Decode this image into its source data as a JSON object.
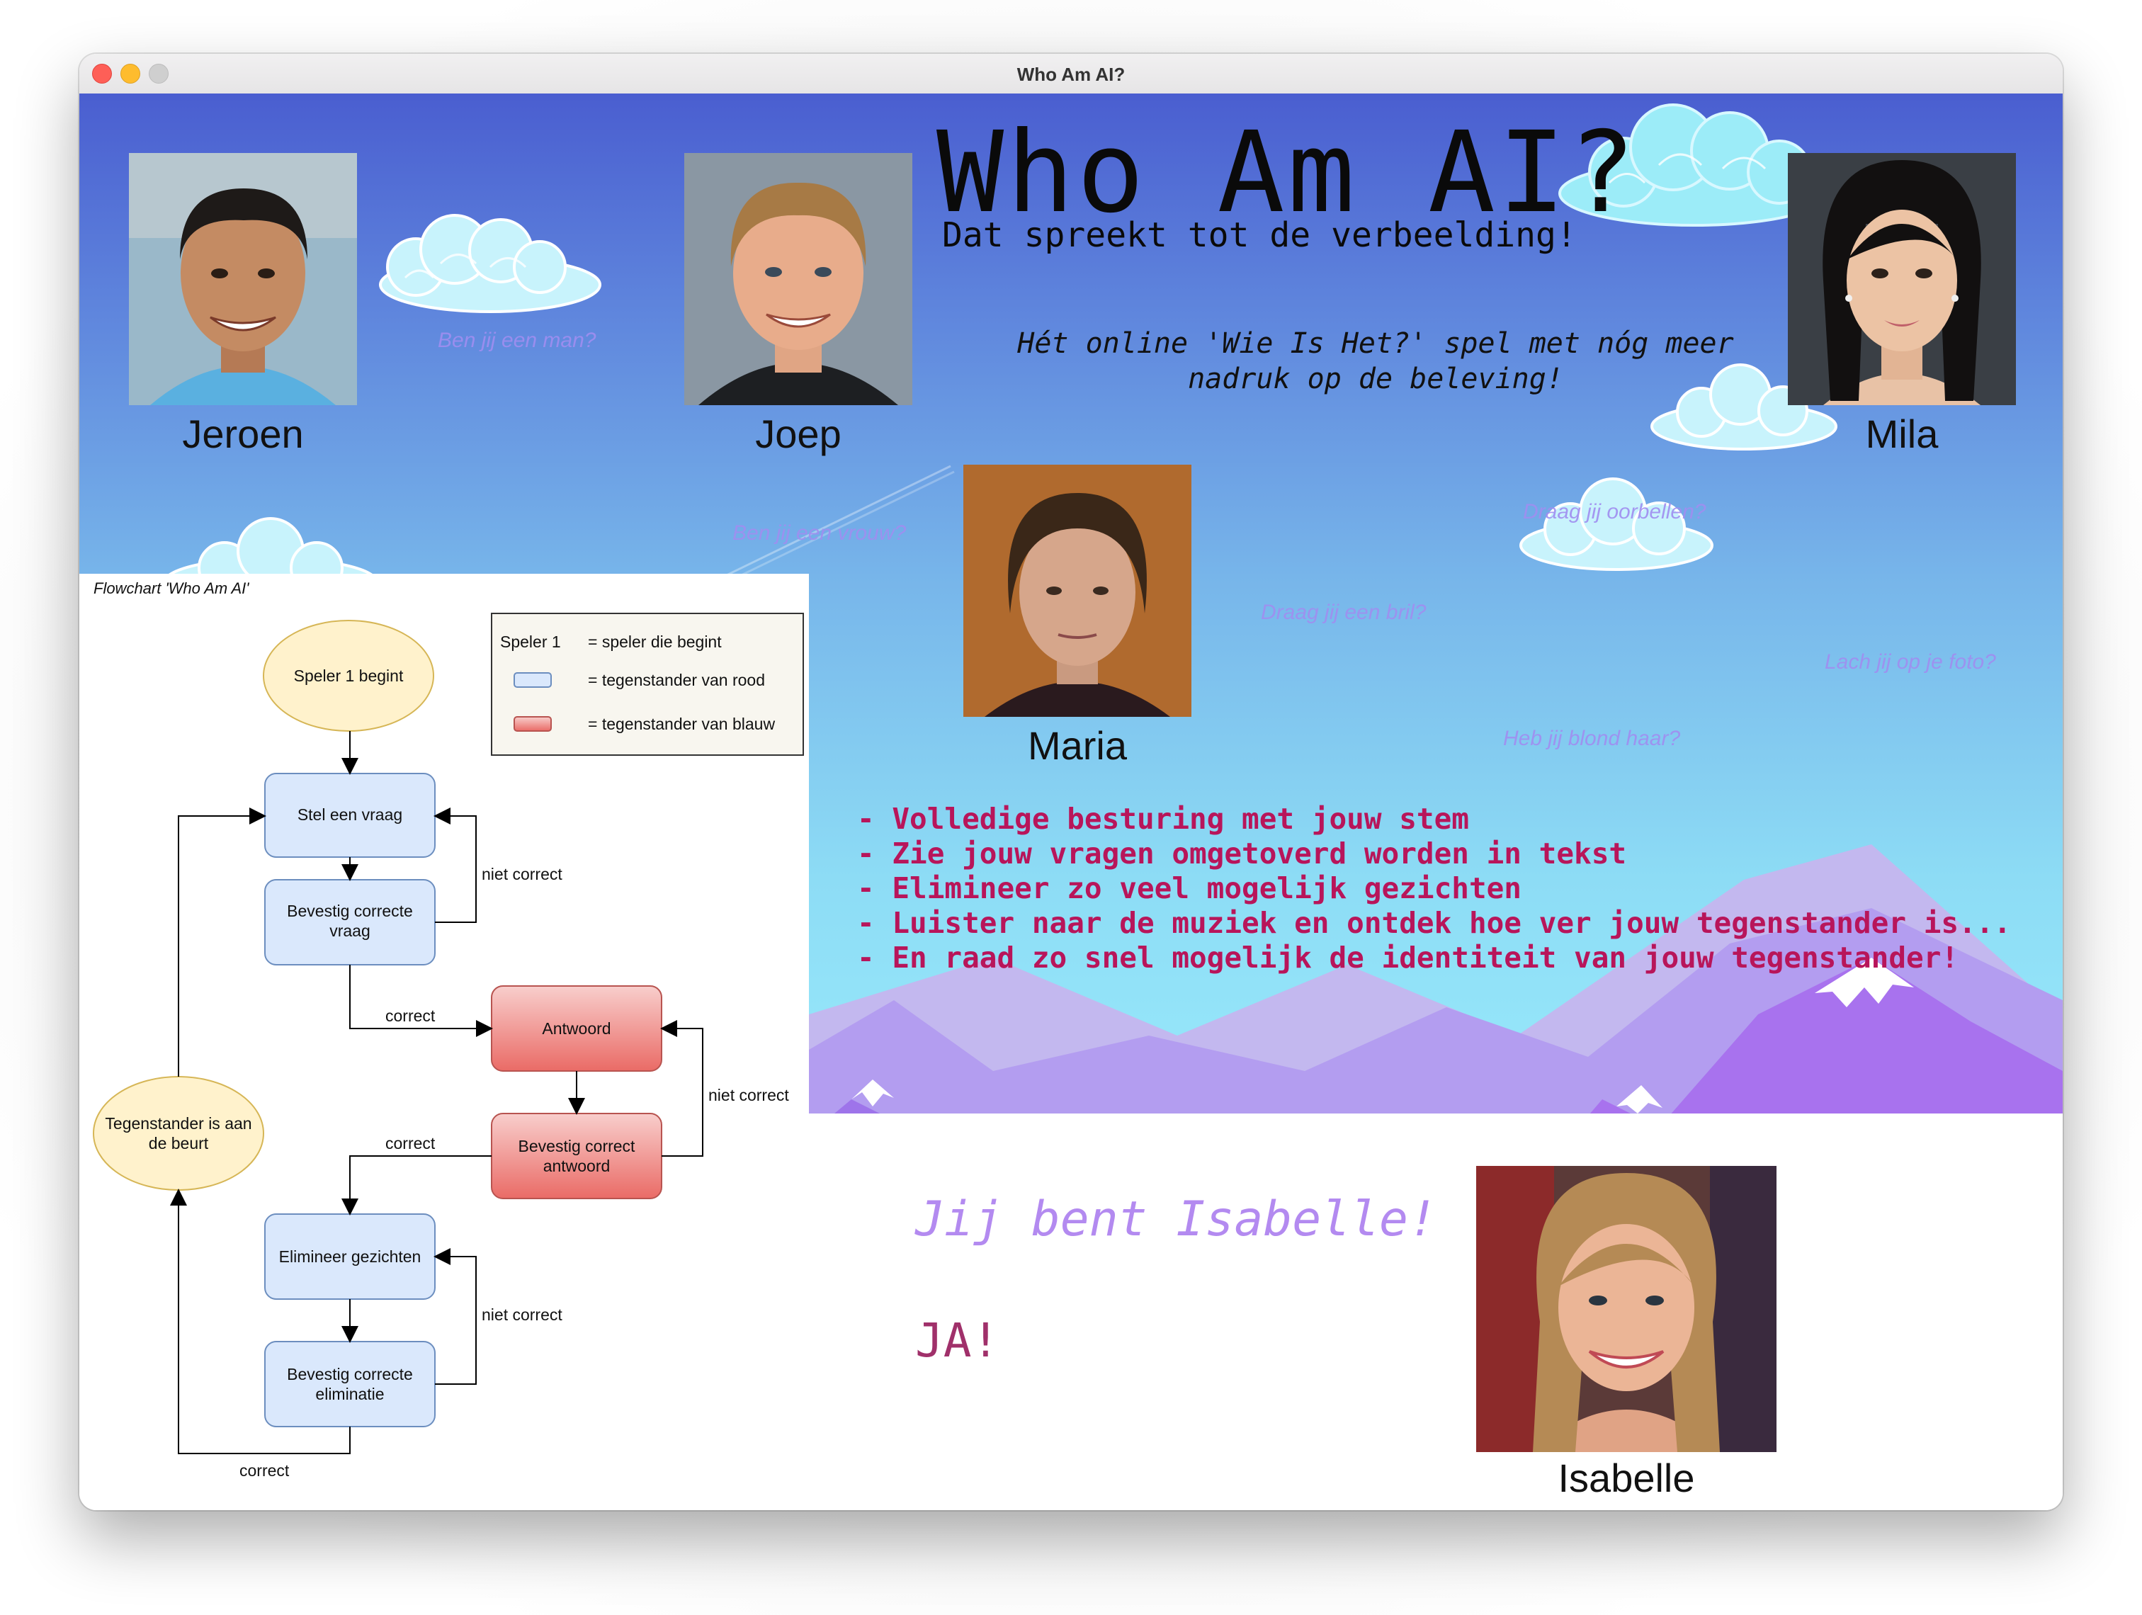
{
  "window": {
    "title": "Who Am AI?"
  },
  "hero": {
    "title": "Who Am AI?",
    "subtitle": "Dat spreekt tot de verbeelding!",
    "tagline_line1": "Hét online 'Wie Is Het?' spel met nóg meer",
    "tagline_line2": "nadruk op de beleving!"
  },
  "characters": [
    {
      "name": "Jeroen"
    },
    {
      "name": "Joep"
    },
    {
      "name": "Mila"
    },
    {
      "name": "Maria"
    },
    {
      "name": "Isabelle"
    }
  ],
  "floating_questions": [
    "Ben jij een man?",
    "Ben jij een vrouw?",
    "Draag jij oorbellen?",
    "Draag jij een bril?",
    "Lach jij op je foto?",
    "Heb jij blond haar?"
  ],
  "features": [
    "- Volledige besturing met jouw stem",
    "- Zie jouw vragen omgetoverd worden in tekst",
    "- Elimineer zo veel mogelijk gezichten",
    "- Luister naar de muziek en ontdek hoe ver jouw tegenstander is...",
    "- En raad zo snel mogelijk de identiteit van jouw tegenstander!"
  ],
  "result": {
    "you_are": "Jij bent Isabelle!",
    "answer": "JA!"
  },
  "flowchart": {
    "caption": "Flowchart 'Who Am AI'",
    "legend": {
      "player_label": "Speler 1",
      "player_desc": "= speler die begint",
      "blue_desc": "= tegenstander van rood",
      "red_desc": "= tegenstander van blauw"
    },
    "nodes": {
      "start": "Speler 1 begint",
      "ask": "Stel een vraag",
      "confirm_question_1": "Bevestig correcte",
      "confirm_question_2": "vraag",
      "answer": "Antwoord",
      "confirm_answer_1": "Bevestig correct",
      "confirm_answer_2": "antwoord",
      "eliminate": "Elimineer gezichten",
      "confirm_elim_1": "Bevestig correcte",
      "confirm_elim_2": "eliminatie",
      "opponent_1": "Tegenstander is aan",
      "opponent_2": "de beurt"
    },
    "edges": {
      "not_correct": "niet correct",
      "correct": "correct"
    }
  },
  "colors": {
    "feature_text": "#b8155a",
    "you_are_text": "#b38af0",
    "answer_text": "#a0306a",
    "blue_node": "#dae8fc",
    "red_node": "#f19c99",
    "start_node": "#fff2cc"
  }
}
